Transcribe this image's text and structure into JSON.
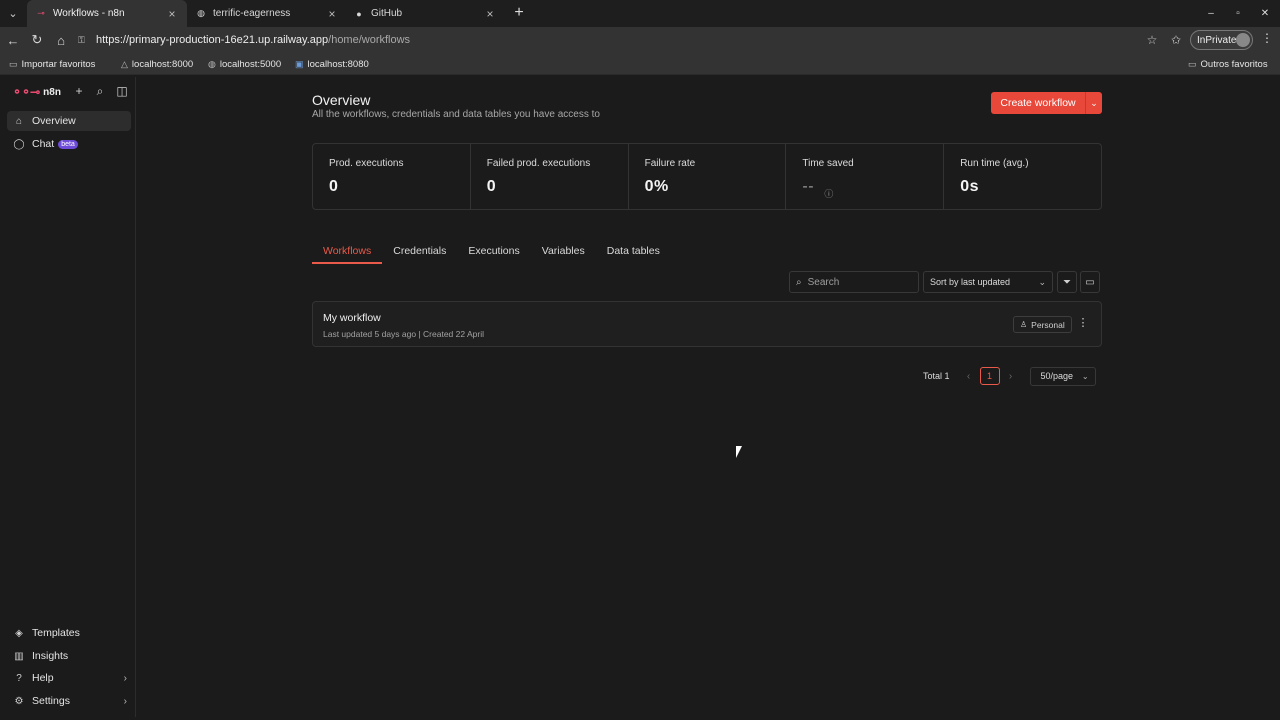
{
  "browser": {
    "tabs": [
      {
        "title": "Workflows - n8n",
        "active": true
      },
      {
        "title": "terrific-eagerness",
        "active": false
      },
      {
        "title": "GitHub",
        "active": false
      }
    ],
    "url_host": "https://primary-production-16e21.up.railway.app",
    "url_path": "/home/workflows",
    "inprivate_label": "InPrivate",
    "bookmarks": [
      "Importar favoritos",
      "localhost:8000",
      "localhost:5000",
      "localhost:8080"
    ],
    "other_bookmarks": "Outros favoritos"
  },
  "sidebar": {
    "app_name": "n8n",
    "top_items": [
      {
        "label": "Overview"
      },
      {
        "label": "Chat",
        "badge": "beta"
      }
    ],
    "bottom_items": [
      {
        "label": "Templates"
      },
      {
        "label": "Insights"
      },
      {
        "label": "Help"
      },
      {
        "label": "Settings"
      }
    ]
  },
  "main": {
    "title": "Overview",
    "subtitle": "All the workflows, credentials and data tables you have access to",
    "create_button": "Create workflow",
    "stats": [
      {
        "label": "Prod. executions",
        "value": "0"
      },
      {
        "label": "Failed prod. executions",
        "value": "0"
      },
      {
        "label": "Failure rate",
        "value": "0%"
      },
      {
        "label": "Time saved",
        "value": "--"
      },
      {
        "label": "Run time (avg.)",
        "value": "0s"
      }
    ],
    "tabs": [
      "Workflows",
      "Credentials",
      "Executions",
      "Variables",
      "Data tables"
    ],
    "search_placeholder": "Search",
    "sort_label": "Sort by last updated",
    "workflow": {
      "name": "My workflow",
      "meta": "Last updated 5 days ago |  Created 22 April",
      "owner": "Personal"
    },
    "pagination": {
      "total": "Total 1",
      "page": "1",
      "per_page": "50/page"
    }
  },
  "colors": {
    "accent": "#ea5a4a",
    "create_button": "#e8483a",
    "beta_badge": "#6e4bd8",
    "brand": "#ea4b71"
  }
}
